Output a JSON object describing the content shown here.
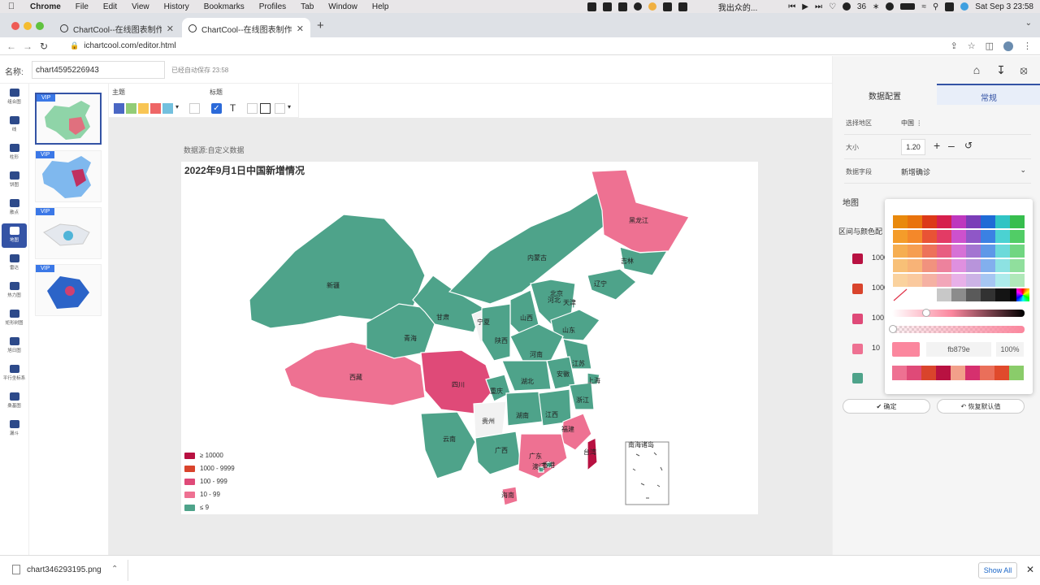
{
  "menubar": {
    "app": "Chrome",
    "items": [
      "File",
      "Edit",
      "View",
      "History",
      "Bookmarks",
      "Profiles",
      "Tab",
      "Window",
      "Help"
    ],
    "now_playing": "我出众的...",
    "badge": "36",
    "datetime": "Sat Sep 3  23:58"
  },
  "browser": {
    "tabs": [
      {
        "title": "ChartCool--在线图表制作工具",
        "active": false
      },
      {
        "title": "ChartCool--在线图表制作工具",
        "active": true
      }
    ],
    "url": "ichartcool.com/editor.html"
  },
  "app_header": {
    "name_label": "名称:",
    "chart_name": "chart4595226943",
    "autosave": "已经自动保存 23:58"
  },
  "left_nav": [
    {
      "label": "组合图",
      "icon": "combo-chart-icon"
    },
    {
      "label": "线",
      "icon": "line-chart-icon"
    },
    {
      "label": "柱形",
      "icon": "bar-chart-icon"
    },
    {
      "label": "饼图",
      "icon": "pie-chart-icon"
    },
    {
      "label": "散点",
      "icon": "scatter-chart-icon"
    },
    {
      "label": "地图",
      "icon": "map-chart-icon",
      "active": true
    },
    {
      "label": "雷达",
      "icon": "radar-chart-icon"
    },
    {
      "label": "热力图",
      "icon": "heatmap-icon"
    },
    {
      "label": "矩形树图",
      "icon": "treemap-icon"
    },
    {
      "label": "旭日图",
      "icon": "sunburst-icon"
    },
    {
      "label": "平行坐标系",
      "icon": "parallel-coords-icon"
    },
    {
      "label": "桑基图",
      "icon": "sankey-icon"
    },
    {
      "label": "漏斗",
      "icon": "funnel-icon"
    }
  ],
  "thumbnails": [
    {
      "badge": "VIP",
      "active": true
    },
    {
      "badge": "VIP"
    },
    {
      "badge": "VIP"
    },
    {
      "badge": "VIP"
    }
  ],
  "style_toolbar": {
    "theme_label": "主题",
    "title_label": "标题",
    "theme_colors": [
      "#4a67c4",
      "#92cc76",
      "#f8c554",
      "#ee6666",
      "#73c0de"
    ]
  },
  "canvas": {
    "data_source": "数据源:自定义数据",
    "title": "2022年9月1日中国新增情况"
  },
  "chart_data": {
    "type": "map",
    "title": "2022年9月1日中国新增情况",
    "legend": [
      {
        "label": "≥ 10000",
        "color": "#b81141"
      },
      {
        "label": "1000 - 9999",
        "color": "#d9442c"
      },
      {
        "label": "100 - 999",
        "color": "#df4a78"
      },
      {
        "label": "10 - 99",
        "color": "#ee7192"
      },
      {
        "label": "≤ 9",
        "color": "#4ea38a"
      }
    ],
    "regions": [
      {
        "name": "新疆",
        "bucket": "≤ 9"
      },
      {
        "name": "西藏",
        "bucket": "10 - 99"
      },
      {
        "name": "青海",
        "bucket": "≤ 9"
      },
      {
        "name": "甘肃",
        "bucket": "≤ 9"
      },
      {
        "name": "内蒙古",
        "bucket": "≤ 9"
      },
      {
        "name": "黑龙江",
        "bucket": "10 - 99"
      },
      {
        "name": "吉林",
        "bucket": "≤ 9"
      },
      {
        "name": "辽宁",
        "bucket": "≤ 9"
      },
      {
        "name": "北京",
        "bucket": "≤ 9"
      },
      {
        "name": "天津",
        "bucket": "≤ 9"
      },
      {
        "name": "河北",
        "bucket": "≤ 9"
      },
      {
        "name": "山西",
        "bucket": "≤ 9"
      },
      {
        "name": "山东",
        "bucket": "≤ 9"
      },
      {
        "name": "宁夏",
        "bucket": "none"
      },
      {
        "name": "陕西",
        "bucket": "≤ 9"
      },
      {
        "name": "河南",
        "bucket": "≤ 9"
      },
      {
        "name": "江苏",
        "bucket": "≤ 9"
      },
      {
        "name": "上海",
        "bucket": "≤ 9"
      },
      {
        "name": "安徽",
        "bucket": "≤ 9"
      },
      {
        "name": "四川",
        "bucket": "100 - 999"
      },
      {
        "name": "重庆",
        "bucket": "≤ 9"
      },
      {
        "name": "湖北",
        "bucket": "≤ 9"
      },
      {
        "name": "浙江",
        "bucket": "≤ 9"
      },
      {
        "name": "贵州",
        "bucket": "none"
      },
      {
        "name": "湖南",
        "bucket": "≤ 9"
      },
      {
        "name": "江西",
        "bucket": "≤ 9"
      },
      {
        "name": "福建",
        "bucket": "10 - 99"
      },
      {
        "name": "云南",
        "bucket": "≤ 9"
      },
      {
        "name": "广西",
        "bucket": "≤ 9"
      },
      {
        "name": "广东",
        "bucket": "10 - 99"
      },
      {
        "name": "香港",
        "bucket": "≤ 9"
      },
      {
        "name": "澳门",
        "bucket": "≤ 9"
      },
      {
        "name": "台湾",
        "bucket": "≥ 10000"
      },
      {
        "name": "海南",
        "bucket": "10 - 99"
      }
    ],
    "inset_label": "南海诸岛"
  },
  "right_panel": {
    "tabs": [
      "数据配置",
      "常规"
    ],
    "active_tab": "常规",
    "rows": [
      {
        "label": "选择地区",
        "value": "中国"
      },
      {
        "label": "大小",
        "value": "1.20"
      },
      {
        "label": "数据字段",
        "value": "新增确诊"
      }
    ],
    "section_map": "地图",
    "section_ranges": "区间与颜色配",
    "ranges": [
      {
        "value": "1000",
        "color": "#b81141"
      },
      {
        "value": "1000",
        "color": "#d9442c"
      },
      {
        "value": "100",
        "color": "#df4a78"
      },
      {
        "value": "10",
        "color": "#ee7192"
      },
      {
        "value": "",
        "color": "#4ea38a"
      }
    ],
    "confirm_label": "确定",
    "reset_label": "恢复默认值"
  },
  "color_picker": {
    "hex": "fb879e",
    "alpha": "100%",
    "current_color": "#fb879e",
    "recent_colors": [
      "#ee7192",
      "#df4a78",
      "#d9442c",
      "#b81141",
      "#f2a08a",
      "#d6306e",
      "#ea6f5a",
      "#e04a2c",
      "#8acc6a"
    ]
  },
  "download_bar": {
    "filename": "chart346293195.png",
    "show_all": "Show All"
  }
}
